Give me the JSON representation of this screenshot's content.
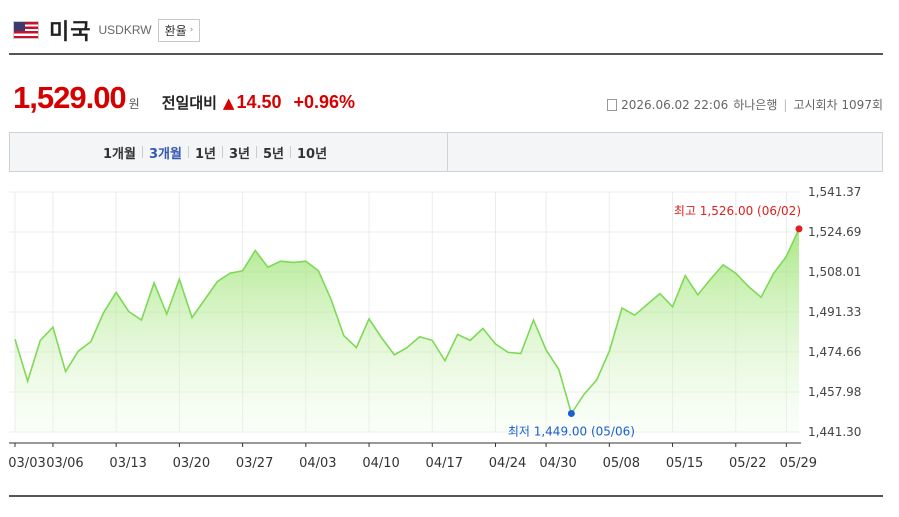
{
  "header": {
    "country": "미국",
    "code": "USDKRW",
    "exchange_button": "환율"
  },
  "price": {
    "value": "1,529.00",
    "unit": "원",
    "compare_label": "전일대비",
    "change": "14.50",
    "change_pct": "+0.96%",
    "direction_color": "#d60000"
  },
  "meta": {
    "datetime": "2026.06.02 22:06",
    "bank": "하나은행",
    "notice": "고시회차 1097회"
  },
  "tabs": [
    {
      "label": "1개월",
      "active": false
    },
    {
      "label": "3개월",
      "active": true
    },
    {
      "label": "1년",
      "active": false
    },
    {
      "label": "3년",
      "active": false
    },
    {
      "label": "5년",
      "active": false
    },
    {
      "label": "10년",
      "active": false
    }
  ],
  "chart_data": {
    "type": "area",
    "line_color": "#7ed957",
    "high_color": "#e02020",
    "low_color": "#1a5fd1",
    "grid": true,
    "ylim": [
      1441.3,
      1541.37
    ],
    "y_ticks": [
      1541.37,
      1524.69,
      1508.01,
      1491.33,
      1474.66,
      1457.98,
      1441.3
    ],
    "y_tick_labels": [
      "1,541.37",
      "1,524.69",
      "1,508.01",
      "1,491.33",
      "1,474.66",
      "1,457.98",
      "1,441.30"
    ],
    "x_tick_labels": [
      "03/03",
      "03/06",
      "03/13",
      "03/20",
      "03/27",
      "04/03",
      "04/10",
      "04/17",
      "04/24",
      "04/30",
      "05/08",
      "05/15",
      "05/22",
      "05/29"
    ],
    "x_tick_index": [
      0,
      3,
      8,
      13,
      18,
      23,
      28,
      33,
      38,
      42,
      47,
      52,
      57,
      61
    ],
    "values": [
      1480.0,
      1462.5,
      1479.5,
      1485.0,
      1466.5,
      1475.0,
      1479.0,
      1491.0,
      1499.5,
      1491.5,
      1488.0,
      1503.5,
      1490.5,
      1505.0,
      1489.0,
      1496.5,
      1504.0,
      1507.5,
      1508.5,
      1517.0,
      1510.0,
      1512.5,
      1512.0,
      1512.5,
      1508.5,
      1496.5,
      1481.5,
      1476.5,
      1488.5,
      1480.5,
      1473.5,
      1476.5,
      1481.0,
      1479.5,
      1471.0,
      1482.0,
      1479.5,
      1484.5,
      1478.0,
      1474.5,
      1474.0,
      1488.0,
      1475.5,
      1467.5,
      1449.0,
      1457.0,
      1463.0,
      1475.0,
      1493.0,
      1490.0,
      1494.5,
      1499.0,
      1493.5,
      1506.5,
      1498.5,
      1505.0,
      1511.0,
      1507.5,
      1502.0,
      1497.5,
      1507.5,
      1514.5,
      1526.0
    ],
    "high_label": "최고 1,526.00 (06/02)",
    "low_label": "최저 1,449.00 (05/06)",
    "high_index": 62,
    "low_index": 44
  }
}
